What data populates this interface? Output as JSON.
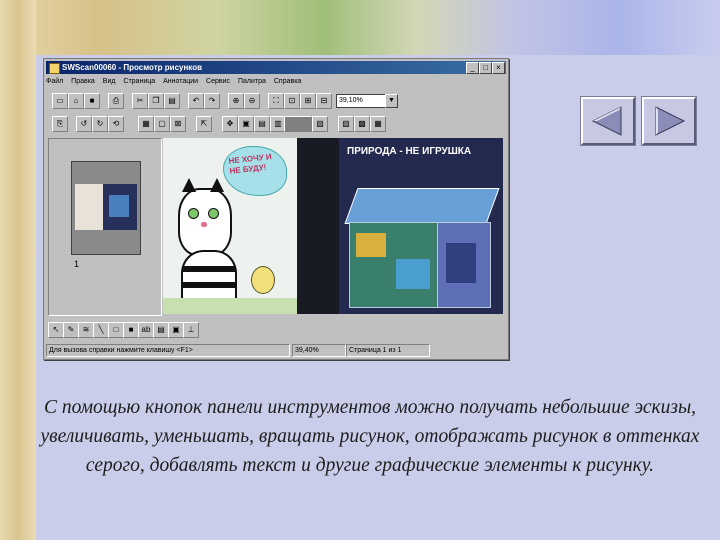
{
  "window": {
    "title": "SWScan00060 - Просмотр рисунков",
    "controls": [
      "_",
      "□",
      "×"
    ]
  },
  "menu": [
    "Файл",
    "Правка",
    "Вид",
    "Страница",
    "Аннотации",
    "Сервис",
    "Палитра",
    "Справка"
  ],
  "toolbar": {
    "zoom_value": "39,10%",
    "zoom_arrow": "▼",
    "row1_icons": [
      "new-icon",
      "open-icon",
      "save-icon",
      "print-icon",
      "cut-icon",
      "copy-icon",
      "paste-icon",
      "undo-icon",
      "redo-icon",
      "zoom-in-icon",
      "zoom-out-icon",
      "fit-icon",
      "zoom-select-icon"
    ],
    "row2_icons": [
      "scan-icon",
      "rotate-left-icon",
      "rotate-right-icon",
      "rotate-icon",
      "thumbnail-icon",
      "page-icon",
      "page-thumbs-icon",
      "select-icon",
      "drag-icon",
      "view-mode-icon",
      "single-page-icon",
      "multi-page-icon",
      "properties-icon",
      "palette-icon"
    ]
  },
  "thumbnail": {
    "page_number": "1"
  },
  "image": {
    "cloud_text": "НЕ ХОЧУ И НЕ БУДУ!",
    "cover_title": "ПРИРОДА - НЕ ИГРУШКА"
  },
  "annotation_toolbar": {
    "icons": [
      "pointer-icon",
      "freehand-icon",
      "highlighter-icon",
      "line-icon",
      "hollow-rect-icon",
      "filled-rect-icon",
      "text-icon",
      "note-icon",
      "stamp-icon"
    ],
    "text_label": "ab"
  },
  "statusbar": {
    "hint": "Для вызова справки нажмите клавишу <F1>",
    "zoom": "39,40%",
    "page": "Страница 1 из 1"
  },
  "nav": {
    "prev_label": "Назад",
    "next_label": "Вперёд"
  },
  "caption": "С помощью кнопок панели инструментов можно получать небольшие эскизы, увеличивать, уменьшать, вращать рисунок, отображать рисунок в оттенках серого, добавлять текст и другие графические элементы к рисунку.",
  "colors": {
    "slide_bg": "#c9cde9",
    "titlebar": "#0a246a",
    "window": "#c0c0c0"
  }
}
